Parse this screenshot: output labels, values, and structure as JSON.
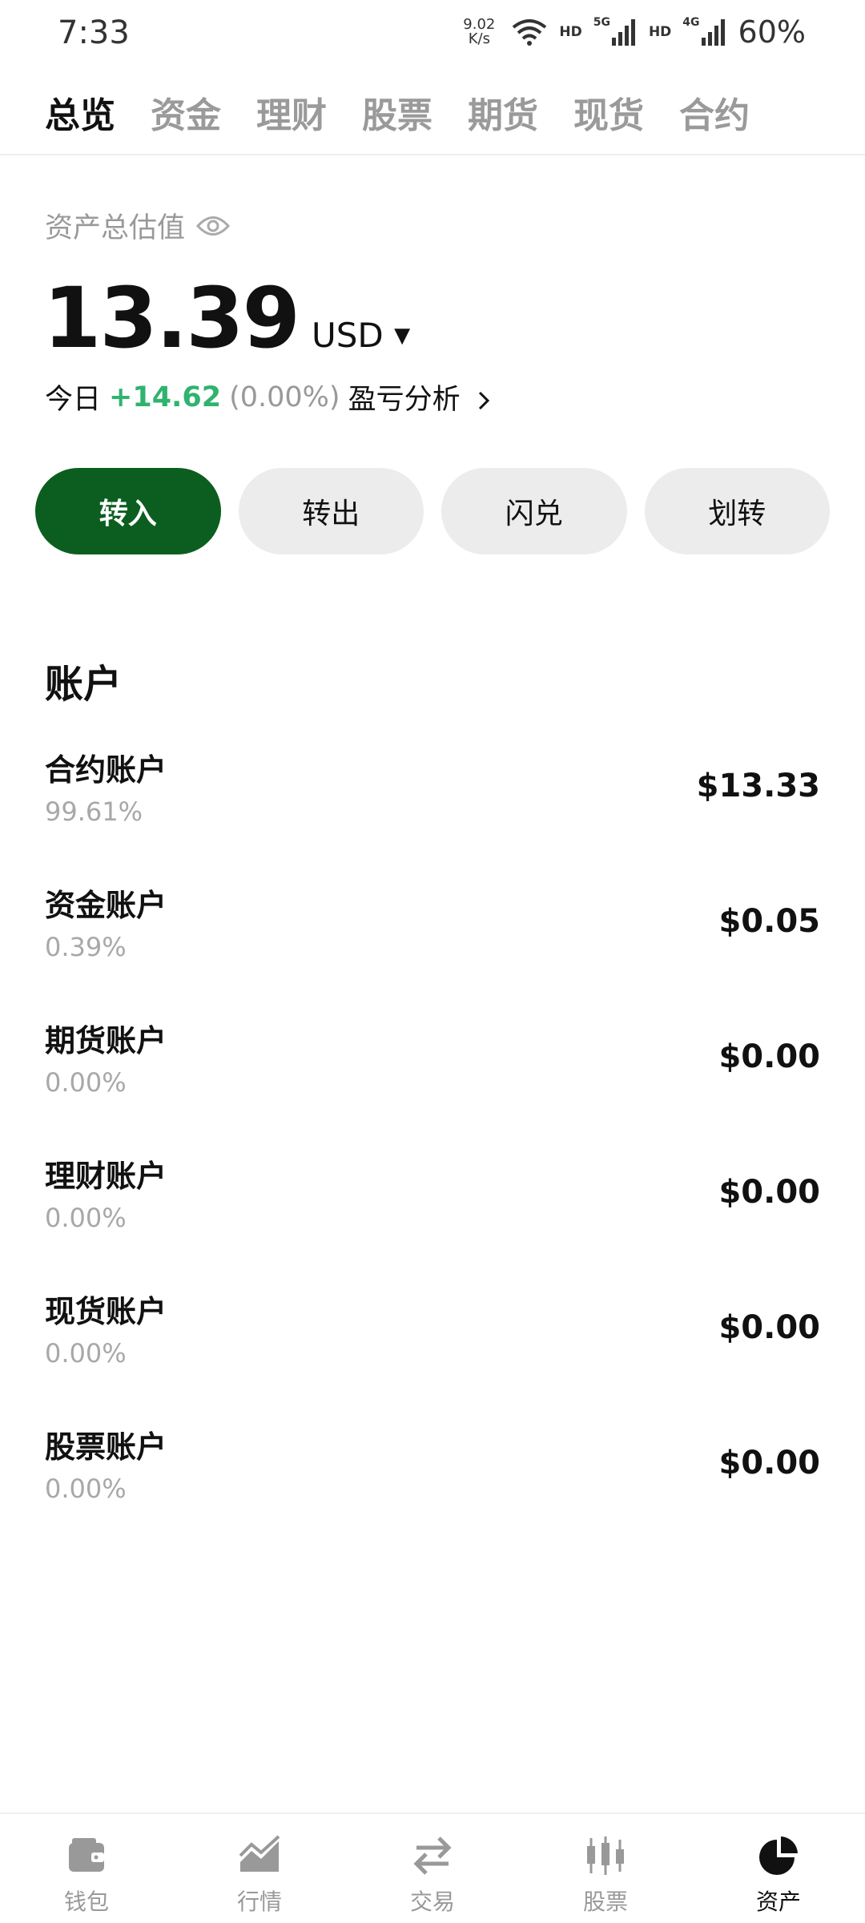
{
  "status_bar": {
    "time": "7:33",
    "net_speed_value": "9.02",
    "net_speed_unit": "K/s",
    "hd_label_1": "HD",
    "network_1": "5G",
    "hd_label_2": "HD",
    "network_2": "4G",
    "battery": "60%"
  },
  "top_tabs": [
    {
      "label": "总览",
      "active": true
    },
    {
      "label": "资金",
      "active": false
    },
    {
      "label": "理财",
      "active": false
    },
    {
      "label": "股票",
      "active": false
    },
    {
      "label": "期货",
      "active": false
    },
    {
      "label": "现货",
      "active": false
    },
    {
      "label": "合约",
      "active": false
    }
  ],
  "summary": {
    "label": "资产总估值",
    "total": "13.39",
    "currency": "USD",
    "today_label": "今日",
    "today_gain": "+14.62",
    "today_pct": "(0.00%)",
    "pnl_link": "盈亏分析"
  },
  "actions": {
    "deposit": "转入",
    "withdraw": "转出",
    "convert": "闪兑",
    "transfer": "划转"
  },
  "accounts": {
    "title": "账户",
    "items": [
      {
        "name": "合约账户",
        "pct": "99.61%",
        "value": "$13.33"
      },
      {
        "name": "资金账户",
        "pct": "0.39%",
        "value": "$0.05"
      },
      {
        "name": "期货账户",
        "pct": "0.00%",
        "value": "$0.00"
      },
      {
        "name": "理财账户",
        "pct": "0.00%",
        "value": "$0.00"
      },
      {
        "name": "现货账户",
        "pct": "0.00%",
        "value": "$0.00"
      },
      {
        "name": "股票账户",
        "pct": "0.00%",
        "value": "$0.00"
      }
    ]
  },
  "bottom_nav": [
    {
      "label": "钱包",
      "icon": "wallet-icon",
      "active": false
    },
    {
      "label": "行情",
      "icon": "market-chart-icon",
      "active": false
    },
    {
      "label": "交易",
      "icon": "trade-arrows-icon",
      "active": false
    },
    {
      "label": "股票",
      "icon": "candlestick-icon",
      "active": false
    },
    {
      "label": "资产",
      "icon": "pie-chart-icon",
      "active": true
    }
  ],
  "colors": {
    "primary_green": "#0b5e1f",
    "gain_green": "#2fb36f",
    "muted_gray": "#999999"
  }
}
